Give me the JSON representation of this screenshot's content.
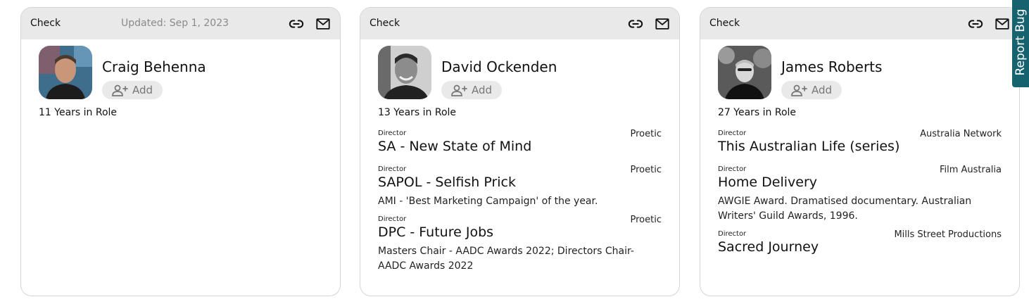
{
  "cards": [
    {
      "check_label": "Check",
      "updated": "Updated: Sep 1, 2023",
      "name": "Craig Behenna",
      "add_label": "Add",
      "years": "11 Years in Role",
      "credits": []
    },
    {
      "check_label": "Check",
      "updated": "",
      "name": "David Ockenden",
      "add_label": "Add",
      "years": "13 Years in Role",
      "credits": [
        {
          "role": "Director",
          "company": "Proetic",
          "title": "SA - New State of Mind",
          "award": ""
        },
        {
          "role": "Director",
          "company": "Proetic",
          "title": "SAPOL - Selfish Prick",
          "award": "AMI - 'Best Marketing Campaign' of the year."
        },
        {
          "role": "Director",
          "company": "Proetic",
          "title": "DPC - Future Jobs",
          "award": "Masters Chair - AADC Awards 2022; Directors Chair- AADC Awards 2022"
        }
      ]
    },
    {
      "check_label": "Check",
      "updated": "",
      "name": "James Roberts",
      "add_label": "Add",
      "years": "27 Years in Role",
      "credits": [
        {
          "role": "Director",
          "company": "Australia Network",
          "title": "This Australian Life (series)",
          "award": ""
        },
        {
          "role": "Director",
          "company": "Film Australia",
          "title": "Home Delivery",
          "award": "AWGIE Award. Dramatised documentary. Australian Writers' Guild Awards, 1996."
        },
        {
          "role": "Director",
          "company": "Mills Street Productions",
          "title": "Sacred Journey",
          "award": ""
        }
      ]
    }
  ],
  "report_bug_label": "Report Bug",
  "icons": {
    "link": "link-icon",
    "mail": "mail-icon",
    "add_person": "add-person-icon"
  },
  "colors": {
    "header_bg": "#e9e9e9",
    "report_bug_bg": "#17626f",
    "updated_text": "#8a8a8a"
  }
}
